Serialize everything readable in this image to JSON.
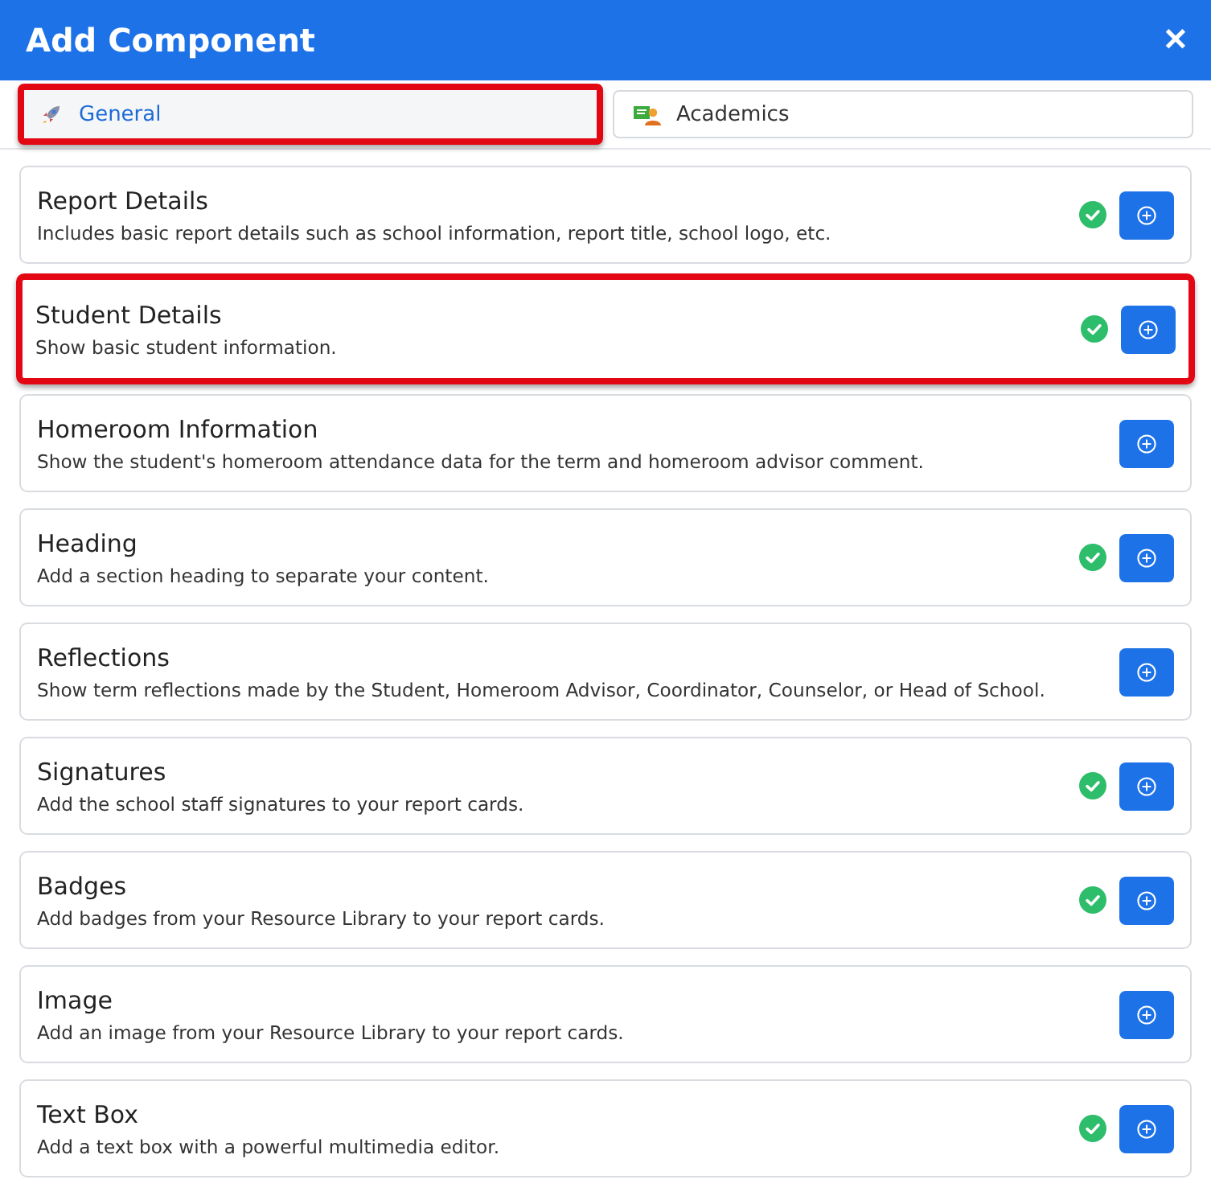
{
  "window": {
    "title": "Add Component",
    "close": "✕"
  },
  "tabs": [
    {
      "label": "General",
      "selected": true,
      "highlighted": true
    },
    {
      "label": "Academics",
      "selected": false,
      "highlighted": false
    }
  ],
  "components": [
    {
      "title": "Report Details",
      "description": "Includes basic report details such as school information, report title, school logo, etc.",
      "added": true,
      "highlighted": false
    },
    {
      "title": "Student Details",
      "description": "Show basic student information.",
      "added": true,
      "highlighted": true
    },
    {
      "title": "Homeroom Information",
      "description": "Show the student's homeroom attendance data for the term and homeroom advisor comment.",
      "added": false,
      "highlighted": false
    },
    {
      "title": "Heading",
      "description": "Add a section heading to separate your content.",
      "added": true,
      "highlighted": false
    },
    {
      "title": "Reflections",
      "description": "Show term reflections made by the Student, Homeroom Advisor, Coordinator, Counselor, or Head of School.",
      "added": false,
      "highlighted": false
    },
    {
      "title": "Signatures",
      "description": "Add the school staff signatures to your report cards.",
      "added": true,
      "highlighted": false
    },
    {
      "title": "Badges",
      "description": "Add badges from your Resource Library to your report cards.",
      "added": true,
      "highlighted": false
    },
    {
      "title": "Image",
      "description": "Add an image from your Resource Library to your report cards.",
      "added": false,
      "highlighted": false
    },
    {
      "title": "Text Box",
      "description": "Add a text box with a powerful multimedia editor.",
      "added": true,
      "highlighted": false
    }
  ]
}
